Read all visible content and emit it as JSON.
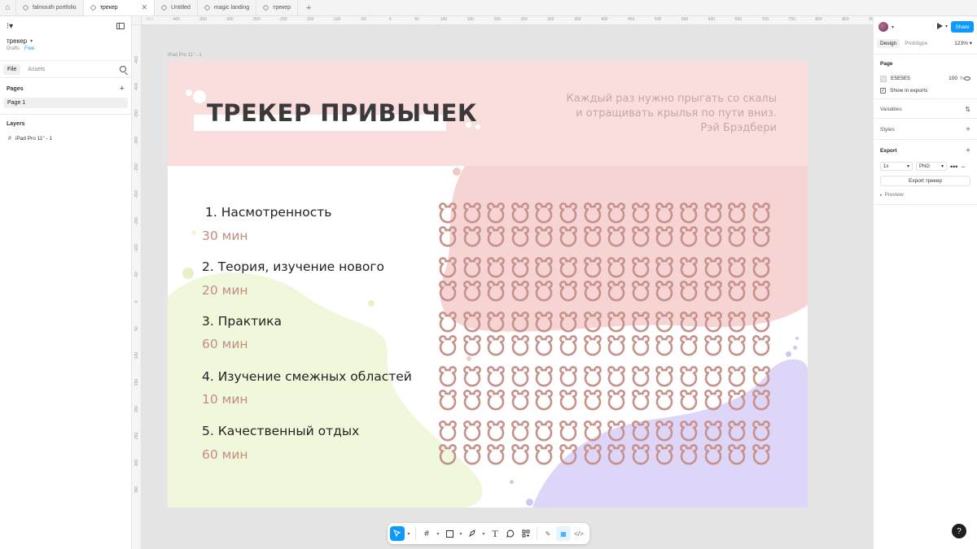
{
  "tabs": [
    {
      "label": "falmouth portfolio",
      "active": false
    },
    {
      "label": "трекер",
      "active": true
    },
    {
      "label": "Untitled",
      "active": false
    },
    {
      "label": "magic landing",
      "active": false
    },
    {
      "label": "трекер",
      "active": false
    }
  ],
  "left_panel": {
    "file_name": "трекер",
    "location": "Drafts",
    "plan": "Free",
    "tabs": [
      "File",
      "Assets"
    ],
    "pages_title": "Pages",
    "pages": [
      "Page 1"
    ],
    "layers_title": "Layers",
    "layers": [
      "iPad Pro 11\" - 1"
    ]
  },
  "rulers": {
    "h": [
      "-450",
      "-400",
      "-350",
      "-300",
      "-250",
      "-200",
      "-150",
      "-100",
      "-50",
      "0",
      "50",
      "100",
      "150",
      "200",
      "250",
      "300",
      "350",
      "400",
      "450",
      "500",
      "550",
      "600",
      "650",
      "700",
      "750",
      "800",
      "850",
      "900",
      "950"
    ],
    "v": [
      "-450",
      "-400",
      "-350",
      "-300",
      "-250",
      "-200",
      "-150",
      "-100",
      "-50",
      "0",
      "50",
      "100",
      "150",
      "200",
      "250",
      "300",
      "350"
    ]
  },
  "canvas": {
    "frame_label": "iPad Pro 11\" - 1",
    "title": "ТРЕКЕР ПРИВЫЧЕК",
    "quote_lines": [
      "Каждый раз нужно прыгать со скалы",
      "и отращивать крылья по пути вниз.",
      "Рэй Брэдбери"
    ],
    "habits": [
      {
        "name": "1. Насмотренность",
        "time": "30 мин"
      },
      {
        "name": "2. Теория, изучение нового",
        "time": "20 мин"
      },
      {
        "name": "3. Практика",
        "time": "60 мин"
      },
      {
        "name": "4. Изучение смежных областей",
        "time": "10 мин"
      },
      {
        "name": "5. Качественный отдых",
        "time": "60 мин"
      }
    ],
    "tracker": {
      "rows": 10,
      "columns": 14,
      "icon": "bear-icon",
      "color": "#c7928c"
    },
    "colors": {
      "header": "#f9dedd",
      "pink_blob": "#f5d4d3",
      "green_blob": "#f0f8dc",
      "lavender_blob": "#ddd6f9"
    }
  },
  "toolbar": {
    "tools": [
      "move-tool",
      "frame-tool",
      "shape-tool",
      "pen-tool",
      "text-tool",
      "comment-tool",
      "actions-tool"
    ],
    "modes": [
      "draw-mode",
      "design-mode",
      "dev-mode"
    ]
  },
  "right_panel": {
    "share": "Share",
    "tabs": [
      "Design",
      "Prototype"
    ],
    "zoom": "123%",
    "page_title": "Page",
    "bg_color": "E5E5E5",
    "bg_opacity": "100",
    "opacity_unit": "%",
    "show_in_exports": "Show in exports",
    "variables": "Variables",
    "styles": "Styles",
    "export_title": "Export",
    "export_scale": "1x",
    "export_format": "PNG",
    "export_button": "Export трекер",
    "preview": "Preview",
    "help": "?"
  }
}
